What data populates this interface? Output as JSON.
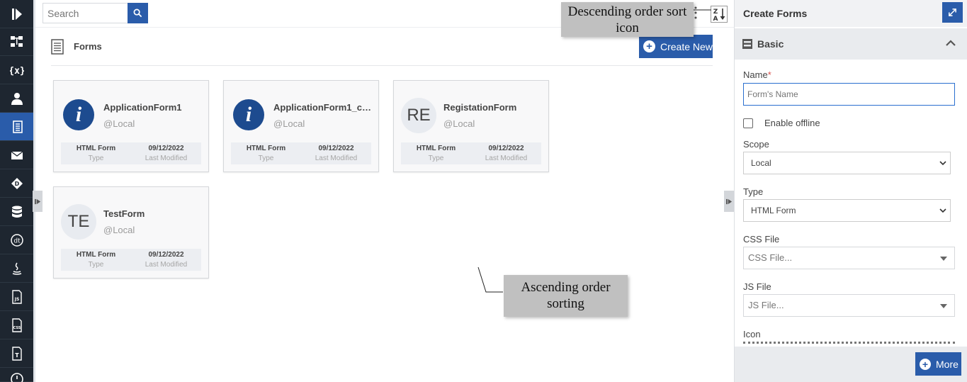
{
  "search": {
    "placeholder": "Search"
  },
  "forms": {
    "title": "Forms",
    "create_new_label": "Create New",
    "cards": [
      {
        "name": "ApplicationForm1",
        "scope": "@Local",
        "avatar_type": "info-icon",
        "type_value": "HTML Form",
        "type_key": "Type",
        "modified_value": "09/12/2022",
        "modified_key": "Last Modified"
      },
      {
        "name": "ApplicationForm1_co...",
        "scope": "@Local",
        "avatar_type": "info-icon",
        "type_value": "HTML Form",
        "type_key": "Type",
        "modified_value": "09/12/2022",
        "modified_key": "Last Modified"
      },
      {
        "name": "RegistationForm",
        "scope": "@Local",
        "avatar_initials": "RE",
        "type_value": "HTML Form",
        "type_key": "Type",
        "modified_value": "09/12/2022",
        "modified_key": "Last Modified"
      },
      {
        "name": "TestForm",
        "scope": "@Local",
        "avatar_initials": "TE",
        "type_value": "HTML Form",
        "type_key": "Type",
        "modified_value": "09/12/2022",
        "modified_key": "Last Modified"
      }
    ]
  },
  "annotations": {
    "descending": "Descending order sort icon",
    "ascending": "Ascending order sorting"
  },
  "panel": {
    "title": "Create Forms",
    "section": "Basic",
    "name_label": "Name",
    "required_mark": "*",
    "name_placeholder": "Form's Name",
    "offline_label": "Enable offline",
    "scope_label": "Scope",
    "scope_value": "Local",
    "type_label": "Type",
    "type_value": "HTML Form",
    "css_label": "CSS File",
    "css_placeholder": "CSS File...",
    "js_label": "JS File",
    "js_placeholder": "JS File...",
    "icon_label": "Icon",
    "more_label": "More"
  },
  "nav_icons": [
    "logo-icon",
    "flow-icon",
    "variables-icon",
    "user-icon",
    "forms-icon",
    "mail-icon",
    "decision-icon",
    "database-icon",
    "datatable-icon",
    "java-icon",
    "js-file-icon",
    "css-file-icon",
    "text-file-icon",
    "clock-icon"
  ],
  "colors": {
    "accent": "#2a5caa",
    "nav_bg": "#1e2630",
    "annotation_bg": "#c0c0c0"
  }
}
